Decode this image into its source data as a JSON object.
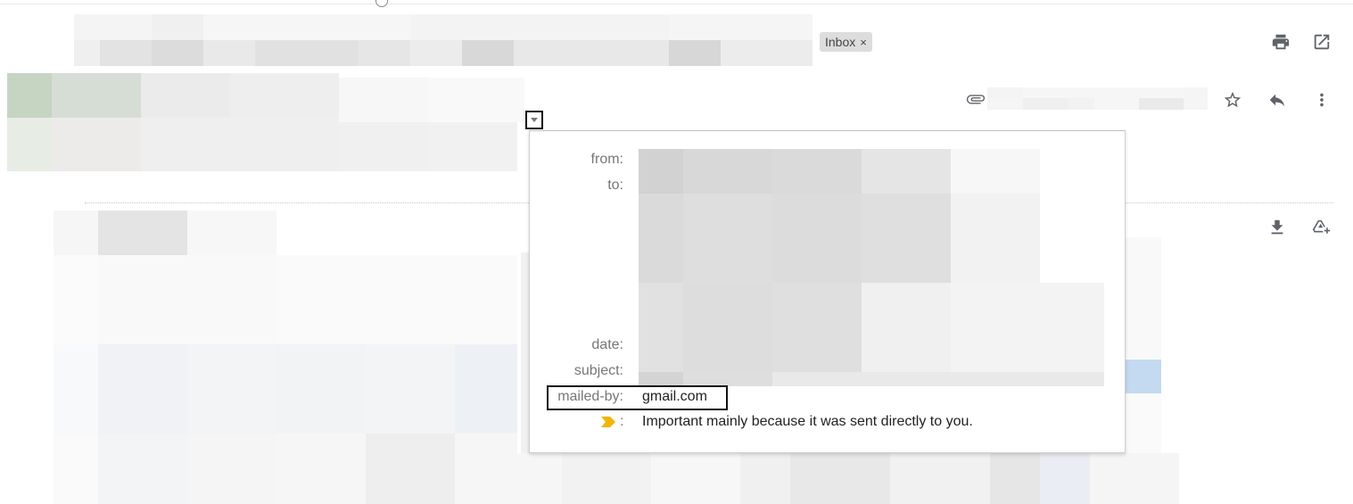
{
  "labels": {
    "inbox_chip": "Inbox",
    "inbox_chip_remove": "×"
  },
  "toolbar": {
    "print_icon": "print-icon",
    "open_new_window_icon": "open-in-new-window-icon",
    "attachment_icon": "paperclip-icon",
    "star_icon": "star-icon",
    "reply_icon": "reply-icon",
    "more_icon": "more-vert-icon",
    "download_icon": "download-icon",
    "add_to_drive_icon": "add-to-drive-icon"
  },
  "details_popup": {
    "from_label": "from:",
    "to_label": "to:",
    "date_label": "date:",
    "subject_label": "subject:",
    "mailed_by_label": "mailed-by:",
    "mailed_by_value": "gmail.com",
    "importance_separator": ":",
    "importance_text": "Important mainly because it was sent directly to you."
  },
  "colors": {
    "importance_marker": "#f4b400",
    "chip_bg": "#dddddd",
    "icon": "#5f6368"
  }
}
